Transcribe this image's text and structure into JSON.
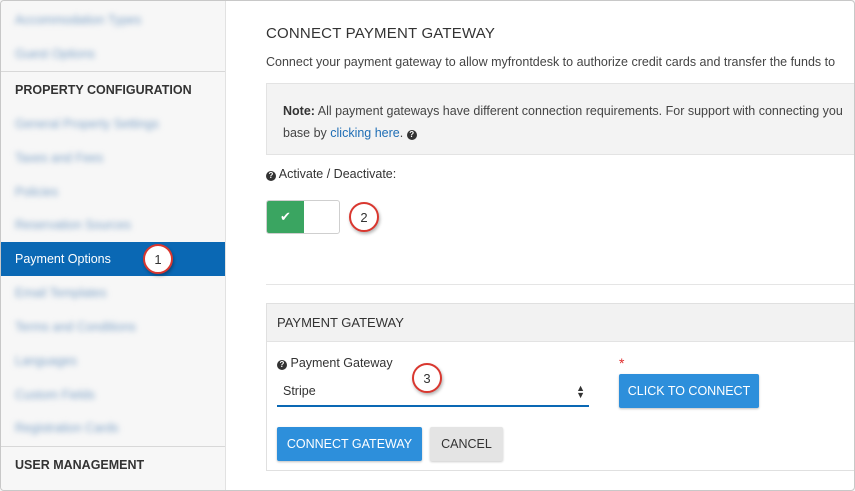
{
  "sidebar": {
    "top_items": [
      {
        "label": "Accommodation Types"
      },
      {
        "label": "Guest Options"
      }
    ],
    "property_configuration_header": "PROPERTY CONFIGURATION",
    "property_items": [
      {
        "label": "General Property Settings"
      },
      {
        "label": "Taxes and Fees"
      },
      {
        "label": "Policies"
      },
      {
        "label": "Reservation Sources"
      },
      {
        "label": "Payment Options"
      },
      {
        "label": "Email Templates"
      },
      {
        "label": "Terms and Conditions"
      },
      {
        "label": "Languages"
      },
      {
        "label": "Custom Fields"
      },
      {
        "label": "Registration Cards"
      }
    ],
    "active_item": "Payment Options",
    "user_management_header": "USER MANAGEMENT"
  },
  "main": {
    "title": "CONNECT PAYMENT GATEWAY",
    "description": "Connect your payment gateway to allow myfrontdesk to authorize credit cards and transfer the funds to",
    "note": {
      "bold": "Note:",
      "line1": "All payment gateways have different connection requirements. For support with connecting you",
      "line2_prefix": "base by ",
      "link_text": "clicking here",
      "line2_suffix": "."
    },
    "activate_label": "Activate / Deactivate:",
    "toggle_state": "on",
    "panel": {
      "title": "PAYMENT GATEWAY",
      "field_label": "Payment Gateway",
      "selected_value": "Stripe",
      "required_mark": "*",
      "click_to_connect": "CLICK TO CONNECT",
      "connect_gateway": "CONNECT GATEWAY",
      "cancel": "CANCEL"
    }
  },
  "callouts": [
    "1",
    "2",
    "3"
  ],
  "colors": {
    "active_sidebar": "#0a68b4",
    "toggle_on": "#3aa561",
    "primary_button": "#2d8fdb",
    "callout_border": "#d9372f"
  }
}
